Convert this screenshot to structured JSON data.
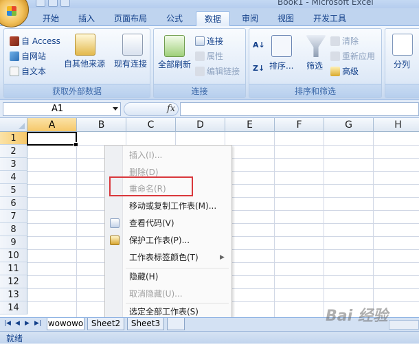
{
  "window": {
    "title": "Book1 - Microsoft Excel"
  },
  "ribbon_tabs": [
    "开始",
    "插入",
    "页面布局",
    "公式",
    "数据",
    "审阅",
    "视图",
    "开发工具"
  ],
  "active_tab": "数据",
  "groups": {
    "get_external": {
      "label": "获取外部数据",
      "access": "自 Access",
      "web": "自网站",
      "text": "自文本",
      "other_sources": "自其他来源",
      "existing": "现有连接"
    },
    "connections": {
      "label": "连接",
      "refresh_all": "全部刷新",
      "connections": "连接",
      "properties": "属性",
      "edit_links": "编辑链接"
    },
    "sort_filter": {
      "label": "排序和筛选",
      "sort": "排序...",
      "filter": "筛选",
      "clear": "清除",
      "reapply": "重新应用",
      "advanced": "高级"
    },
    "data_tools": {
      "split": "分列"
    }
  },
  "formula_bar": {
    "name_box": "A1",
    "fx": "fx",
    "value": ""
  },
  "columns": [
    "A",
    "B",
    "C",
    "D",
    "E",
    "F",
    "G",
    "H"
  ],
  "rows": [
    "1",
    "2",
    "3",
    "4",
    "5",
    "6",
    "7",
    "8",
    "9",
    "10",
    "11",
    "12",
    "13",
    "14"
  ],
  "context_menu": {
    "items": [
      {
        "label": "插入(I)...",
        "disabled": true
      },
      {
        "label": "删除(D)",
        "disabled": true
      },
      {
        "label": "重命名(R)",
        "disabled": true
      },
      {
        "label": "移动或复制工作表(M)...",
        "disabled": false
      },
      {
        "label": "查看代码(V)",
        "disabled": false
      },
      {
        "label": "保护工作表(P)...",
        "disabled": false
      },
      {
        "label": "工作表标签颜色(T)",
        "disabled": false
      },
      {
        "label": "隐藏(H)",
        "disabled": false
      },
      {
        "label": "取消隐藏(U)...",
        "disabled": true
      },
      {
        "label": "选定全部工作表(S)",
        "disabled": false
      }
    ]
  },
  "sheet_tabs": [
    "wowowo",
    "Sheet2",
    "Sheet3"
  ],
  "active_sheet": "wowowo",
  "status": "就绪",
  "watermark": "Bai 经验"
}
